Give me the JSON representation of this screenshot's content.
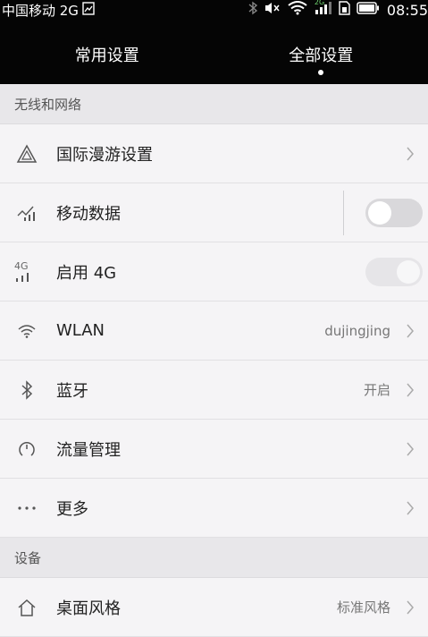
{
  "status_bar": {
    "carrier": "中国移动 2G",
    "network_badge": "2G",
    "time": "08:55",
    "icons": [
      "sim-card-icon",
      "bluetooth-icon",
      "mute-icon",
      "wifi-icon",
      "signal-icon",
      "sim-icon",
      "battery-icon"
    ]
  },
  "tabs": [
    {
      "label": "常用设置",
      "active": false
    },
    {
      "label": "全部设置",
      "active": true
    }
  ],
  "sections": [
    {
      "header": "无线和网络",
      "items": [
        {
          "label": "国际漫游设置",
          "icon": "roaming-triangle-icon",
          "control": "chevron"
        },
        {
          "label": "移动数据",
          "icon": "mobile-data-icon",
          "control": "toggle",
          "toggle_state": "off"
        },
        {
          "label": "启用 4G",
          "icon": "4g-signal-icon",
          "icon_text": "4G",
          "control": "toggle",
          "toggle_state": "disabled"
        },
        {
          "label": "WLAN",
          "icon": "wifi-icon",
          "value": "dujingjing",
          "control": "chevron"
        },
        {
          "label": "蓝牙",
          "icon": "bluetooth-icon",
          "value": "开启",
          "control": "chevron"
        },
        {
          "label": "流量管理",
          "icon": "traffic-gauge-icon",
          "control": "chevron"
        },
        {
          "label": "更多",
          "icon": "more-dots-icon",
          "control": "chevron"
        }
      ]
    },
    {
      "header": "设备",
      "items": [
        {
          "label": "桌面风格",
          "icon": "home-icon",
          "value": "标准风格",
          "control": "chevron"
        }
      ]
    }
  ],
  "colors": {
    "topbar": "#050505",
    "background": "#f5f4f6",
    "section_header": "#e8e7ea"
  }
}
